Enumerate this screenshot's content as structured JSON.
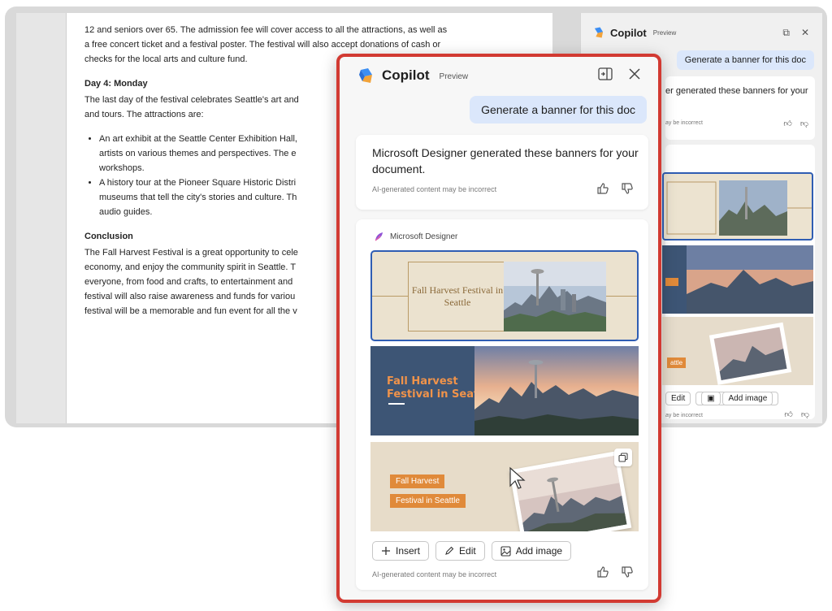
{
  "document": {
    "line_1": "12 and seniors over 65. The admission fee will cover access to all the attractions, as well as",
    "line_2": "a free concert ticket and a festival poster. The festival will also accept donations of cash or",
    "line_3": "checks for the local arts and culture fund.",
    "day4_heading": "Day 4: Monday",
    "day4_line_1": "The last day of the festival celebrates Seattle's art and",
    "day4_line_2": "and tours. The attractions are:",
    "bullet_1_line_1": "An art exhibit at the Seattle Center Exhibition Hall,",
    "bullet_1_line_2": "artists on various themes and perspectives. The e",
    "bullet_1_line_3": "workshops.",
    "bullet_2_line_1": "A history tour at the Pioneer Square Historic Distri",
    "bullet_2_line_2": "museums that tell the city's stories and culture. Th",
    "bullet_2_line_3": "audio guides.",
    "conclusion_heading": "Conclusion",
    "conclusion_line_1": "The Fall Harvest Festival is a great opportunity to cele",
    "conclusion_line_2": "economy, and enjoy the community spirit in Seattle. T",
    "conclusion_line_3": "everyone, from food and crafts, to entertainment and",
    "conclusion_line_4": "festival will also raise awareness and funds for variou",
    "conclusion_line_5": "festival will be a memorable and fun event for all the v"
  },
  "bg_copilot": {
    "title": "Copilot",
    "subtitle": "Preview",
    "prompt": "Generate a banner for this doc",
    "response_fragment": "er generated these banners for your",
    "note_fragment": "ay be incorrect",
    "edit_label": "Edit",
    "add_image_label": "Add image",
    "foot_fragment": "ay be incorrect",
    "banner3_tag": "attle"
  },
  "copilot": {
    "title": "Copilot",
    "subtitle": "Preview",
    "prompt": "Generate a banner for this doc",
    "response": "Microsoft Designer generated these banners for your document.",
    "disclaimer": "AI-generated content may be incorrect",
    "designer_label": "Microsoft Designer",
    "banner_1_text": "Fall Harvest Festival in Seattle",
    "banner_2_line_1": "Fall Harvest",
    "banner_2_line_2": "Festival in Seattle",
    "banner_3_tag_1": "Fall Harvest",
    "banner_3_tag_2": "Festival in Seattle",
    "insert_label": "Insert",
    "edit_label": "Edit",
    "add_image_label": "Add image",
    "designer_disclaimer": "AI-generated content may be incorrect"
  },
  "colors": {
    "highlight_border": "#d23a32",
    "prompt_bubble": "#dbe7fb",
    "selected_banner": "#2f5db3"
  },
  "icons": [
    "copilot-logo-icon",
    "open-in-pane-icon",
    "close-icon",
    "thumbs-up-icon",
    "thumbs-down-icon",
    "designer-logo-icon",
    "copy-icon",
    "plus-icon",
    "pencil-icon",
    "image-icon"
  ]
}
